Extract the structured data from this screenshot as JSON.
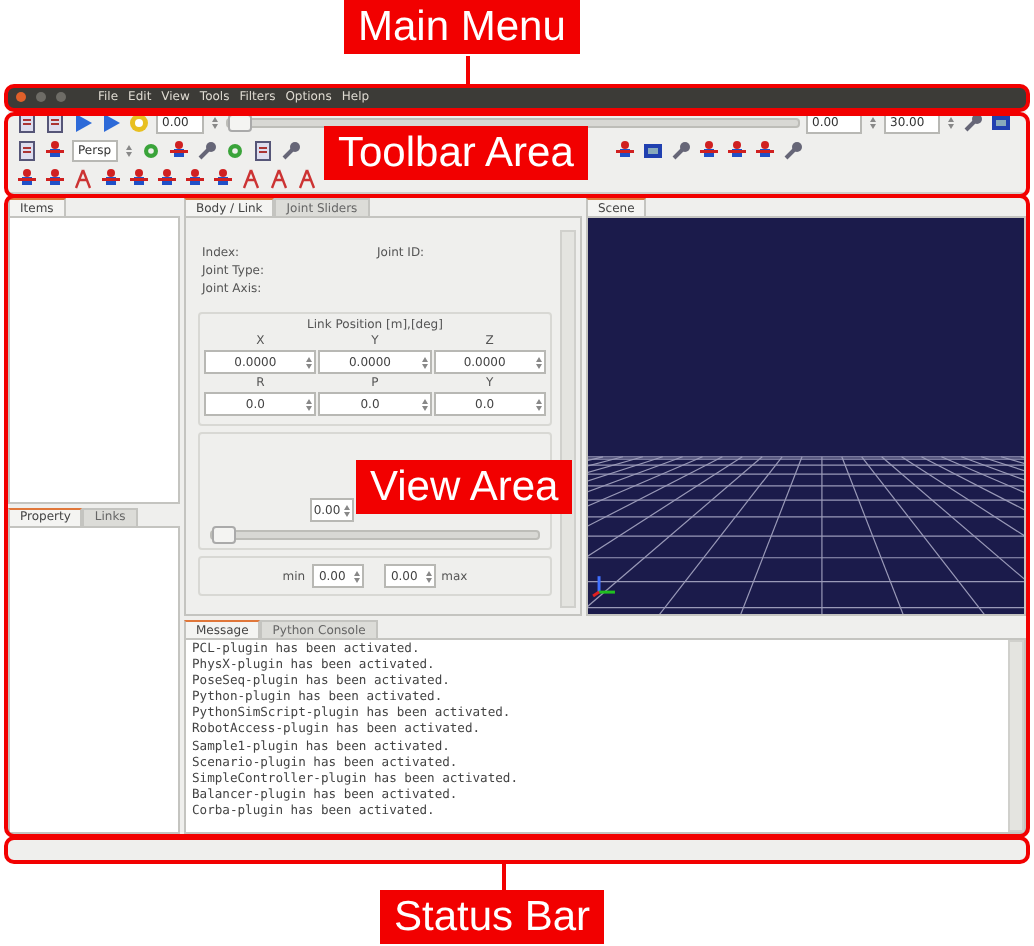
{
  "annotations": [
    {
      "label": "Main Menu"
    },
    {
      "label": "Toolbar Area"
    },
    {
      "label": "View Area"
    },
    {
      "label": "Status Bar"
    }
  ],
  "menu": [
    "File",
    "Edit",
    "View",
    "Tools",
    "Filters",
    "Options",
    "Help"
  ],
  "toolbar": {
    "time": "0.00",
    "time_slider": {
      "level": 0
    },
    "time_step": "0.00",
    "time_end": "30.00",
    "camera_combo": "Persp"
  },
  "items_panel": {
    "tabs": [
      {
        "label": "Items",
        "selected": true
      }
    ]
  },
  "property_panel": {
    "tabs": [
      {
        "label": "Property",
        "selected": true
      },
      {
        "label": "Links",
        "selected": false
      }
    ]
  },
  "body_link": {
    "tabs": [
      {
        "label": "Body / Link",
        "selected": true
      },
      {
        "label": "Joint Sliders",
        "selected": false
      }
    ],
    "info_labels": [
      "Index:",
      "Joint Type:",
      "Joint Axis:"
    ],
    "joint_id_label": "Joint ID:",
    "link_position": {
      "title": "Link Position [m],[deg]",
      "position": [
        {
          "label": "X",
          "value": "0.0000"
        },
        {
          "label": "Y",
          "value": "0.0000"
        },
        {
          "label": "Z",
          "value": "0.0000"
        }
      ],
      "rotation": [
        {
          "label": "R",
          "value": "0.0"
        },
        {
          "label": "P",
          "value": "0.0"
        },
        {
          "label": "Y",
          "value": "0.0"
        }
      ]
    },
    "joint_value": "0.00",
    "joint_slider": {
      "level": 0
    },
    "min_label": "min",
    "min_value": "0.00",
    "max_value": "0.00",
    "max_label": "max"
  },
  "scene": {
    "tabs": [
      {
        "label": "Scene",
        "selected": true
      }
    ]
  },
  "messages": {
    "tabs": [
      {
        "label": "Message",
        "selected": true
      },
      {
        "label": "Python Console",
        "selected": false
      }
    ],
    "lines": [
      "PCL-plugin has been activated.",
      "PhysX-plugin has been activated.",
      "PoseSeq-plugin has been activated.",
      "Python-plugin has been activated.",
      "PythonSimScript-plugin has been activated.",
      "RobotAccess-plugin has been activated.",
      "Sample1-plugin has been activated.",
      "Scenario-plugin has been activated.",
      "SimpleController-plugin has been activated.",
      "Balancer-plugin has been activated.",
      "Corba-plugin has been activated."
    ]
  }
}
